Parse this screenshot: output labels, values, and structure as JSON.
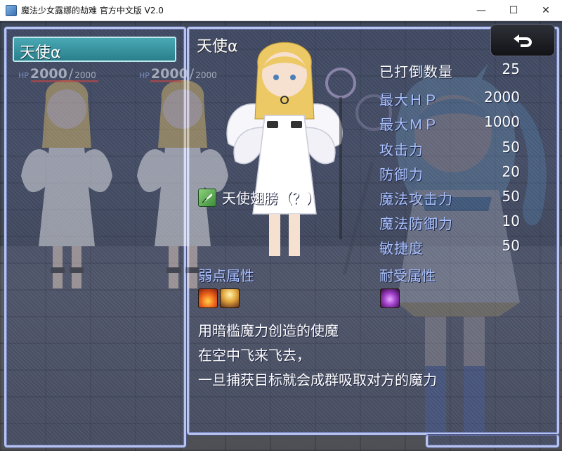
{
  "window": {
    "title": "魔法少女露娜的劫难 官方中文版 V2.0",
    "minimize": "—",
    "maximize": "☐",
    "close": "✕"
  },
  "enemy_list": {
    "selected": "天使α",
    "hp": [
      {
        "label": "HP",
        "current": "2000",
        "sep": "/",
        "max": "2000"
      },
      {
        "label": "HP",
        "current": "2000",
        "sep": "/",
        "max": "2000"
      }
    ]
  },
  "detail": {
    "name": "天使α",
    "return_icon": "return-arrow-icon",
    "stats": [
      {
        "label": "已打倒数量",
        "value": "25"
      },
      {
        "label": "最大ＨＰ",
        "value": "2000"
      },
      {
        "label": "最大ＭＰ",
        "value": "1000"
      },
      {
        "label": "攻击力",
        "value": "50"
      },
      {
        "label": "防御力",
        "value": "20"
      },
      {
        "label": "魔法攻击力",
        "value": "50"
      },
      {
        "label": "魔法防御力",
        "value": "10"
      },
      {
        "label": "敏捷度",
        "value": "50"
      }
    ],
    "drop_item": {
      "label": "天使翅膀（？）",
      "icon": "feather-icon"
    },
    "weakness": {
      "label": "弱点属性",
      "icons": [
        "fire-icon",
        "light-icon"
      ]
    },
    "resist": {
      "label": "耐受属性",
      "icons": [
        "dark-icon"
      ]
    },
    "description": [
      "用暗槛魔力创造的使魔",
      "在空中飞来飞去，",
      "一旦捕获目标就会成群吸取对方的魔力"
    ]
  },
  "colors": {
    "panel_border": "#b8c4ea",
    "stat_label": "#a9c2ff",
    "selection": "#2a7f8c",
    "hp_bar": "#b44848"
  }
}
